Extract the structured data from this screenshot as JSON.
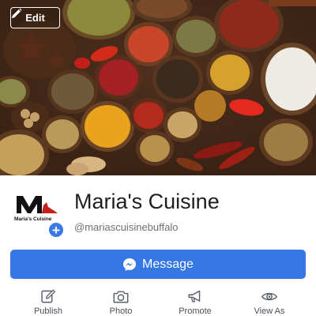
{
  "cover": {
    "edit_label": "Edit"
  },
  "profile": {
    "name": "Maria's Cuisine",
    "handle": "@mariascuisinebuffalo",
    "logo_text": "Maria's Cuisine",
    "badge_glyph": "+"
  },
  "message_button": {
    "label": "Message",
    "color": "#3578e5"
  },
  "actions": [
    {
      "label": "Publish",
      "icon": "pencil-icon"
    },
    {
      "label": "Photo",
      "icon": "camera-icon"
    },
    {
      "label": "Promote",
      "icon": "megaphone-icon"
    },
    {
      "label": "View As",
      "icon": "eye-icon"
    }
  ]
}
